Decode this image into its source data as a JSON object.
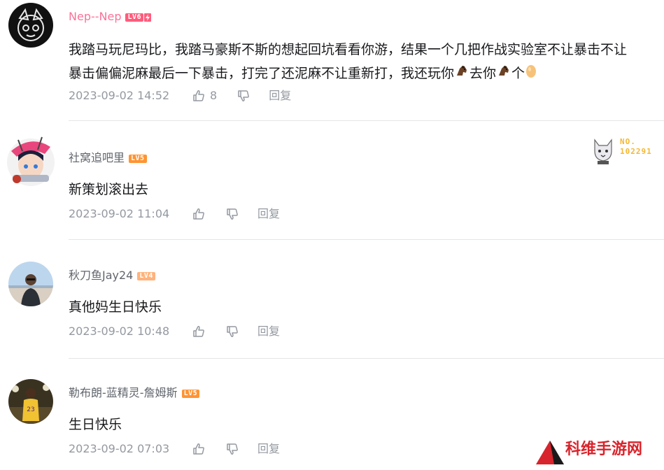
{
  "comments": [
    {
      "username": "Nep--Nep",
      "level": "LV6",
      "text_line1": "我踏马玩尼玛比，我踏马豪斯不斯的想起回坑看看你游，结果一个几把作战实验室不让暴击不让",
      "text_line2_a": "暴击偏偏泥麻最后一下暴击，打完了还泥麻不让重新打，我还玩你",
      "text_line2_b": "去你",
      "text_line2_c": "个",
      "timestamp": "2023-09-02 14:52",
      "likes": "8",
      "reply": "回复"
    },
    {
      "username": "社窝追吧里",
      "level": "LV5",
      "text": "新策划滚出去",
      "timestamp": "2023-09-02 11:04",
      "reply": "回复",
      "badge": "NO.\n102291"
    },
    {
      "username": "秋刀鱼Jay24",
      "level": "LV4",
      "text": "真他妈生日快乐",
      "timestamp": "2023-09-02 10:48",
      "reply": "回复"
    },
    {
      "username": "勒布朗-蓝精灵-詹姆斯",
      "level": "LV5",
      "text": "生日快乐",
      "timestamp": "2023-09-02 07:03",
      "reply": "回复"
    }
  ],
  "badge_no_line1": "NO.",
  "badge_no_line2": "102291",
  "watermark": "科维手游网",
  "colors": {
    "pink": "#fb7299",
    "gray": "#9499a0",
    "lv6": "#ff5c7c",
    "lv5": "#ff9433",
    "lv4": "#ffb37c",
    "watermark": "#d8242c"
  },
  "icons": [
    "like-icon",
    "dislike-icon",
    "horse-emoji",
    "egg-emoji"
  ]
}
